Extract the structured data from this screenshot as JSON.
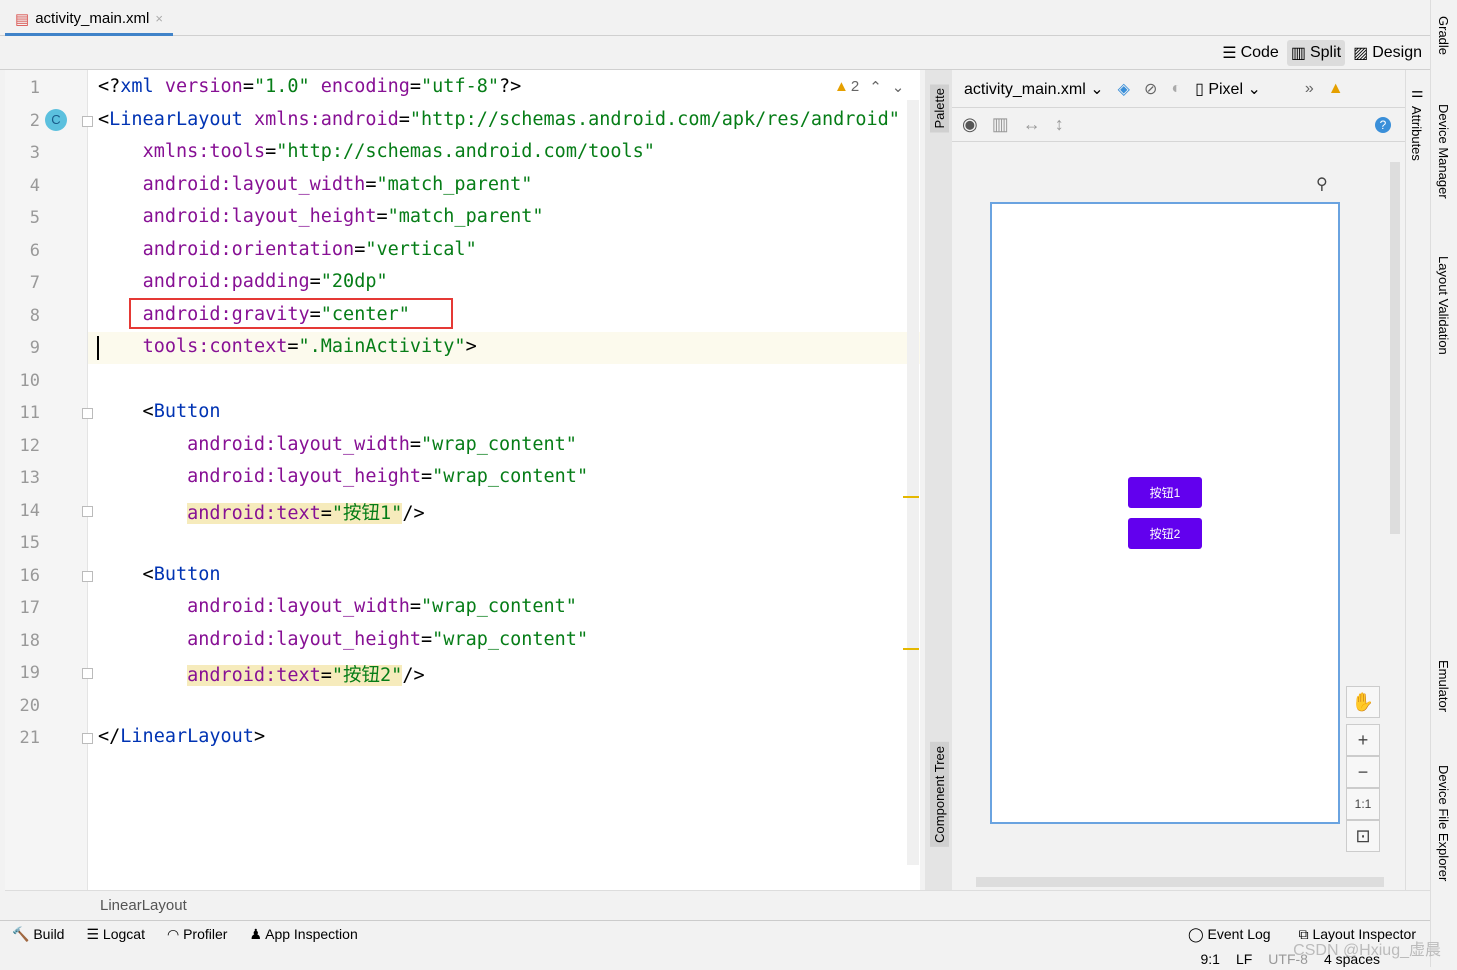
{
  "tab": {
    "label": "activity_main.xml",
    "close": "×"
  },
  "view_modes": [
    "Code",
    "Split",
    "Design"
  ],
  "active_view": "Split",
  "inspection": {
    "warnings": "2"
  },
  "code_lines": [
    [
      [
        "p",
        "<?"
      ],
      [
        "tag",
        "xml "
      ],
      [
        "attr",
        "version"
      ],
      [
        "p",
        "="
      ],
      [
        "val",
        "\"1.0\" "
      ],
      [
        "attr",
        "encoding"
      ],
      [
        "p",
        "="
      ],
      [
        "val",
        "\"utf-8\""
      ],
      [
        "p",
        "?>"
      ]
    ],
    [
      [
        "p",
        "<"
      ],
      [
        "tag",
        "LinearLayout "
      ],
      [
        "attr",
        "xmlns:android"
      ],
      [
        "p",
        "="
      ],
      [
        "val",
        "\"http://schemas.android.com/apk/res/android\""
      ]
    ],
    [
      [
        "p",
        "    "
      ],
      [
        "attr",
        "xmlns:tools"
      ],
      [
        "p",
        "="
      ],
      [
        "val",
        "\"http://schemas.android.com/tools\""
      ]
    ],
    [
      [
        "p",
        "    "
      ],
      [
        "attr",
        "android:layout_width"
      ],
      [
        "p",
        "="
      ],
      [
        "val",
        "\"match_parent\""
      ]
    ],
    [
      [
        "p",
        "    "
      ],
      [
        "attr",
        "android:layout_height"
      ],
      [
        "p",
        "="
      ],
      [
        "val",
        "\"match_parent\""
      ]
    ],
    [
      [
        "p",
        "    "
      ],
      [
        "attr",
        "android:orientation"
      ],
      [
        "p",
        "="
      ],
      [
        "val",
        "\"vertical\""
      ]
    ],
    [
      [
        "p",
        "    "
      ],
      [
        "attr",
        "android:padding"
      ],
      [
        "p",
        "="
      ],
      [
        "val",
        "\"20dp\""
      ]
    ],
    [
      [
        "p",
        "    "
      ],
      [
        "attr",
        "android:gravity"
      ],
      [
        "p",
        "="
      ],
      [
        "val",
        "\"center\""
      ]
    ],
    [
      [
        "p",
        "    "
      ],
      [
        "attr",
        "tools:context"
      ],
      [
        "p",
        "="
      ],
      [
        "val",
        "\".MainActivity\""
      ],
      [
        "p",
        ">"
      ]
    ],
    [],
    [
      [
        "p",
        "    <"
      ],
      [
        "tag",
        "Button"
      ]
    ],
    [
      [
        "p",
        "        "
      ],
      [
        "attr",
        "android:layout_width"
      ],
      [
        "p",
        "="
      ],
      [
        "val",
        "\"wrap_content\""
      ]
    ],
    [
      [
        "p",
        "        "
      ],
      [
        "attr",
        "android:layout_height"
      ],
      [
        "p",
        "="
      ],
      [
        "val",
        "\"wrap_content\""
      ]
    ],
    [
      [
        "p",
        "        "
      ],
      [
        "hlattr",
        "android:text"
      ],
      [
        "hlp",
        "="
      ],
      [
        "hlval",
        "\"按钮1\""
      ],
      [
        "p",
        "/>"
      ]
    ],
    [],
    [
      [
        "p",
        "    <"
      ],
      [
        "tag",
        "Button"
      ]
    ],
    [
      [
        "p",
        "        "
      ],
      [
        "attr",
        "android:layout_width"
      ],
      [
        "p",
        "="
      ],
      [
        "val",
        "\"wrap_content\""
      ]
    ],
    [
      [
        "p",
        "        "
      ],
      [
        "attr",
        "android:layout_height"
      ],
      [
        "p",
        "="
      ],
      [
        "val",
        "\"wrap_content\""
      ]
    ],
    [
      [
        "p",
        "        "
      ],
      [
        "hlattr",
        "android:text"
      ],
      [
        "hlp",
        "="
      ],
      [
        "hlval",
        "\"按钮2\""
      ],
      [
        "p",
        "/>"
      ]
    ],
    [],
    [
      [
        "p",
        "</"
      ],
      [
        "tag",
        "LinearLayout"
      ],
      [
        "p",
        ">"
      ]
    ]
  ],
  "palette": {
    "top": "Palette",
    "bottom": "Component Tree"
  },
  "design": {
    "file": "activity_main.xml",
    "device": "Pixel",
    "buttons": [
      "按钮1",
      "按钮2"
    ],
    "zoom": [
      "+",
      "−",
      "1:1"
    ]
  },
  "right_tools": {
    "attributes": "Attributes",
    "far": [
      "Gradle",
      "Device Manager",
      "Layout Validation",
      "Emulator",
      "Device File Explorer"
    ]
  },
  "breadcrumb": "LinearLayout",
  "bottom_tools": [
    "Build",
    "Logcat",
    "Profiler",
    "App Inspection"
  ],
  "bottom_tools_right": [
    "Event Log",
    "Layout Inspector"
  ],
  "status": {
    "position": "9:1",
    "line_sep": "LF",
    "encoding": "UTF-8",
    "indent": "4 spaces"
  },
  "watermark": "CSDN @Hxiug_虚晨"
}
